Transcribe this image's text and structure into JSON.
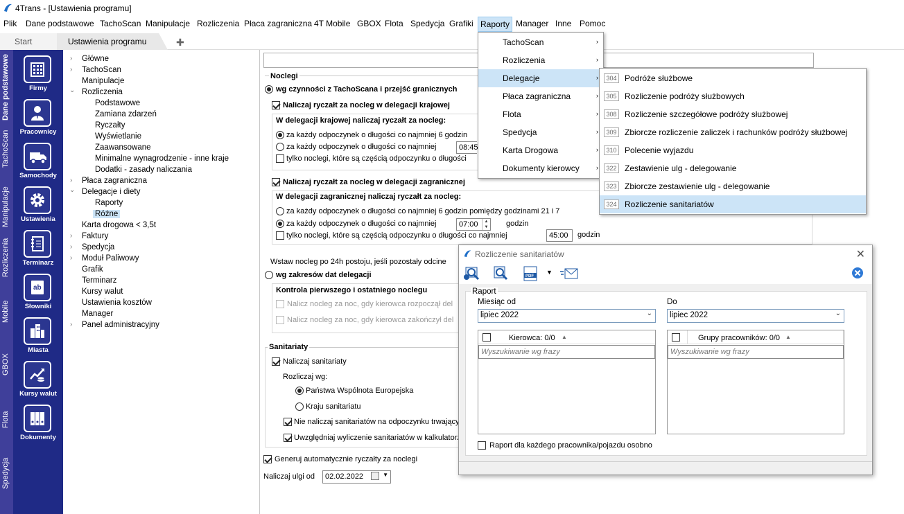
{
  "app": {
    "title": "4Trans - [Ustawienia programu]"
  },
  "menubar": [
    "Plik",
    "Dane podstawowe",
    "TachoScan",
    "Manipulacje",
    "Rozliczenia",
    "Płaca zagraniczna",
    "4T Mobile",
    "GBOX",
    "Flota",
    "Spedycja",
    "Grafiki",
    "Raporty",
    "Manager",
    "Inne",
    "Pomoc"
  ],
  "tabs": {
    "start": "Start",
    "active": "Ustawienia programu",
    "add": "✚"
  },
  "vertical_tabs": [
    "Dane podstawowe",
    "TachoScan",
    "Manipulacje",
    "Rozliczenia",
    "Mobile",
    "GBOX",
    "Flota",
    "Spedycja"
  ],
  "iconbar": [
    {
      "label": "Firmy",
      "icon": "building-icon"
    },
    {
      "label": "Pracownicy",
      "icon": "person-icon"
    },
    {
      "label": "Samochody",
      "icon": "truck-icon"
    },
    {
      "label": "Ustawienia",
      "icon": "gear-icon"
    },
    {
      "label": "Terminarz",
      "icon": "notebook-icon"
    },
    {
      "label": "Słowniki",
      "icon": "dictionary-icon"
    },
    {
      "label": "Miasta",
      "icon": "city-icon"
    },
    {
      "label": "Kursy walut",
      "icon": "currency-chart-icon"
    },
    {
      "label": "Dokumenty",
      "icon": "binders-icon"
    }
  ],
  "tree": [
    {
      "label": "Główne",
      "expander": "›"
    },
    {
      "label": "TachoScan",
      "expander": "›"
    },
    {
      "label": "Manipulacje",
      "expander": ""
    },
    {
      "label": "Rozliczenia",
      "expander": "⌄"
    },
    {
      "label": "Podstawowe",
      "expander": ""
    },
    {
      "label": "Zamiana zdarzeń",
      "expander": ""
    },
    {
      "label": "Ryczałty",
      "expander": ""
    },
    {
      "label": "Wyświetlanie",
      "expander": ""
    },
    {
      "label": "Zaawansowane",
      "expander": ""
    },
    {
      "label": "Minimalne wynagrodzenie - inne kraje",
      "expander": ""
    },
    {
      "label": "Dodatki - zasady naliczania",
      "expander": ""
    },
    {
      "label": "Płaca zagraniczna",
      "expander": "›"
    },
    {
      "label": "Delegacje i diety",
      "expander": "⌄"
    },
    {
      "label": "Raporty",
      "expander": ""
    },
    {
      "label": "Różne",
      "expander": ""
    },
    {
      "label": "Karta drogowa < 3,5t",
      "expander": ""
    },
    {
      "label": "Faktury",
      "expander": "›"
    },
    {
      "label": "Spedycja",
      "expander": "›"
    },
    {
      "label": "Moduł Paliwowy",
      "expander": "›"
    },
    {
      "label": "Grafik",
      "expander": ""
    },
    {
      "label": "Terminarz",
      "expander": ""
    },
    {
      "label": "Kursy walut",
      "expander": ""
    },
    {
      "label": "Ustawienia kosztów",
      "expander": ""
    },
    {
      "label": "Manager",
      "expander": ""
    },
    {
      "label": "Panel administracyjny",
      "expander": "›"
    }
  ],
  "settings": {
    "noclegi_title": "Noclegi",
    "opt_tacho": "wg czynności z TachoScana i przejść granicznych",
    "cb_kraj": "Naliczaj ryczałt za nocleg w delegacji krajowej",
    "kraj_group": "W delegacji krajowej naliczaj ryczałt za nocleg:",
    "kraj_r1": "za każdy odpoczynek o długości co najmniej 6 godzin",
    "kraj_r2": "za każdy odpoczynek o długości co najmniej",
    "kraj_r2_value": "08:45",
    "kraj_cb": "tylko noclegi, które są częścią odpoczynku o długości",
    "cb_zagr": "Naliczaj ryczałt za nocleg w delegacji zagranicznej",
    "zagr_group": "W delegacji zagranicznej naliczaj ryczałt za nocleg:",
    "zagr_r1": "za każdy odpoczynek o długości co najmniej 6 godzin pomiędzy godzinami 21 i 7",
    "zagr_r2": "za każdy odpoczynek o długości co najmniej",
    "zagr_r2_value": "07:00",
    "zagr_r2_unit": "godzin",
    "zagr_cb": "tylko noclegi, które są częścią odpoczynku o długości co najmniej",
    "zagr_cb_value": "45:00",
    "zagr_cb_unit": "godzin",
    "wstaw": "Wstaw nocleg po 24h postoju, jeśli pozostały odcine",
    "opt_zakres": "wg zakresów dat delegacji",
    "kontrola_title": "Kontrola pierwszego i ostatniego noclegu",
    "kontrola_1": "Nalicz nocleg za noc, gdy kierowca rozpoczął del",
    "kontrola_2": "Nalicz nocleg za noc, gdy kierowca zakończył del",
    "sanitariaty_title": "Sanitariaty",
    "cb_sanit": "Naliczaj sanitariaty",
    "rozliczaj": "Rozliczaj wg:",
    "r_panstwa": "Państwa Wspólnota Europejska",
    "r_kraju": "Kraju sanitariatu",
    "cb_nie": "Nie naliczaj sanitariatów na odpoczynku trwającym",
    "cb_uwzgl": "Uwzględniaj wyliczenie sanitariatów w kalkulatorze",
    "cb_generuj": "Generuj automatycznie ryczałty za noclegi",
    "ulgi_label": "Naliczaj ulgi od",
    "ulgi_value": "02.02.2022"
  },
  "raporty_menu": [
    {
      "label": "TachoScan",
      "arrow": "›"
    },
    {
      "label": "Rozliczenia",
      "arrow": "›"
    },
    {
      "label": "Delegacje",
      "arrow": "›"
    },
    {
      "label": "Płaca zagraniczna",
      "arrow": "›"
    },
    {
      "label": "Flota",
      "arrow": "›"
    },
    {
      "label": "Spedycja",
      "arrow": "›"
    },
    {
      "label": "Karta Drogowa",
      "arrow": "›"
    },
    {
      "label": "Dokumenty kierowcy",
      "arrow": "›"
    }
  ],
  "delegacje_submenu": [
    {
      "num": "304",
      "label": "Podróże służbowe"
    },
    {
      "num": "305",
      "label": "Rozliczenie podróży służbowych"
    },
    {
      "num": "308",
      "label": "Rozliczenie szczegółowe podróży służbowej"
    },
    {
      "num": "309",
      "label": "Zbiorcze rozliczenie zaliczek i rachunków podróży służbowej"
    },
    {
      "num": "310",
      "label": "Polecenie wyjazdu"
    },
    {
      "num": "322",
      "label": "Zestawienie ulg - delegowanie"
    },
    {
      "num": "323",
      "label": "Zbiorcze zestawienie ulg - delegowanie"
    },
    {
      "num": "324",
      "label": "Rozliczenie sanitariatów"
    }
  ],
  "dialog": {
    "title": "Rozliczenie sanitariatów",
    "raport_label": "Raport",
    "miesiac_od": "Miesiąc od",
    "miesiac_od_value": "lipiec 2022",
    "do": "Do",
    "do_value": "lipiec 2022",
    "kierowca_header": "Kierowca: 0/0",
    "grupy_header": "Grupy pracowników: 0/0",
    "search_placeholder": "Wyszukiwanie wg frazy",
    "per_employee": "Raport dla każdego pracownika/pojazdu osobno"
  }
}
